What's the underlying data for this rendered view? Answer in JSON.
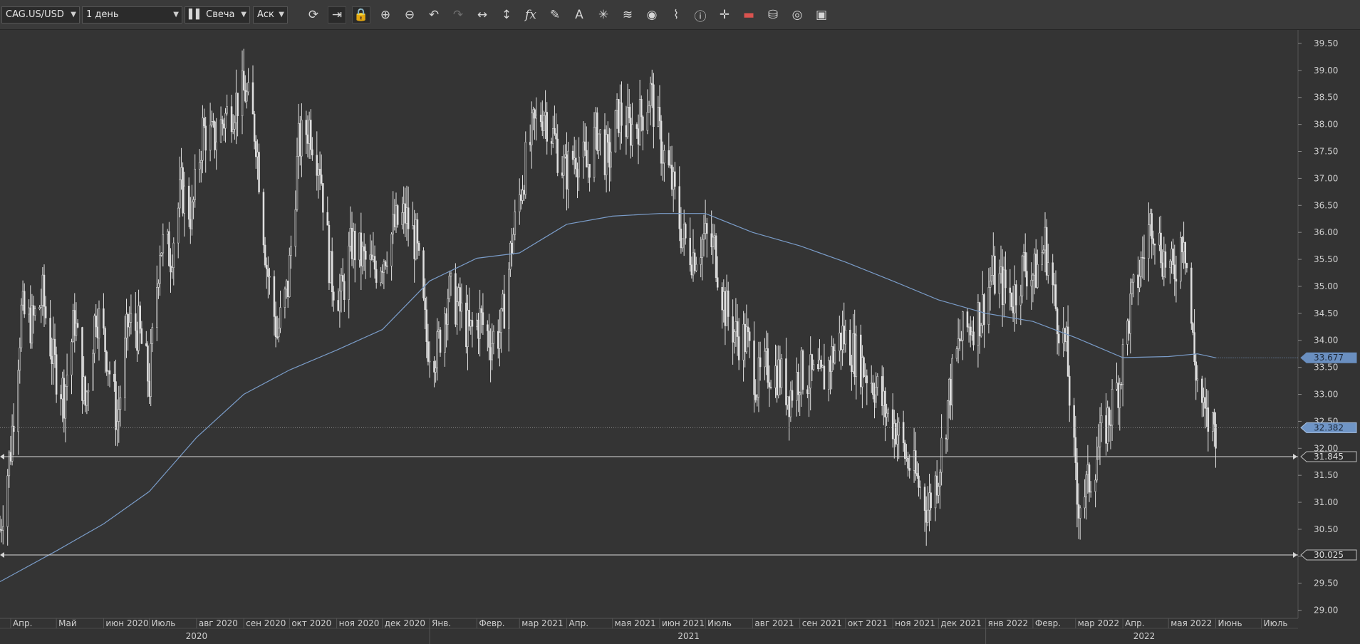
{
  "toolbar": {
    "symbol": "CAG.US/USD",
    "period": "1 день",
    "chart_type": "Свеча",
    "price_side": "Аск",
    "tools": [
      {
        "name": "refresh-icon",
        "glyph": "⟳"
      },
      {
        "name": "shift-chart-icon",
        "glyph": "⇥"
      },
      {
        "name": "lock-icon",
        "glyph": "🔒"
      },
      {
        "name": "zoom-in-icon",
        "glyph": "⊕"
      },
      {
        "name": "zoom-out-icon",
        "glyph": "⊖"
      },
      {
        "name": "undo-icon",
        "glyph": "↶"
      },
      {
        "name": "redo-icon",
        "glyph": "↷"
      },
      {
        "name": "horizontal-stretch-icon",
        "glyph": "↔"
      },
      {
        "name": "vertical-stretch-icon",
        "glyph": "↕"
      },
      {
        "name": "indicators-fx-icon",
        "glyph": "fx"
      },
      {
        "name": "pencil-icon",
        "glyph": "✎"
      },
      {
        "name": "text-tool-icon",
        "glyph": "A"
      },
      {
        "name": "crosshair-tool-icon",
        "glyph": "✳"
      },
      {
        "name": "layers-icon",
        "glyph": "≋"
      },
      {
        "name": "eye-icon",
        "glyph": "◉"
      },
      {
        "name": "alerts-chart-icon",
        "glyph": "⌇"
      },
      {
        "name": "info-icon",
        "glyph": "ⓘ"
      },
      {
        "name": "cursor-cross-icon",
        "glyph": "✛"
      },
      {
        "name": "color-bar-icon",
        "glyph": "▬"
      },
      {
        "name": "paint-bucket-icon",
        "glyph": "⛁"
      },
      {
        "name": "settings-ring-icon",
        "glyph": "◎"
      },
      {
        "name": "save-icon",
        "glyph": "▣"
      }
    ]
  },
  "chart_data": {
    "type": "candlestick",
    "symbol": "CAG.US/USD",
    "timeframe": "1 день",
    "y_ticks": [
      "39.50",
      "39.00",
      "38.50",
      "38.00",
      "37.50",
      "37.00",
      "36.50",
      "36.00",
      "35.50",
      "35.00",
      "34.50",
      "34.00",
      "33.50",
      "33.00",
      "32.50",
      "32.00",
      "31.50",
      "31.00",
      "30.50",
      "30.00",
      "29.50",
      "29.00"
    ],
    "ylim": [
      28.85,
      39.75
    ],
    "x_range": [
      "2020-03-25",
      "2022-07-25"
    ],
    "x_ticks": [
      {
        "date": "2020-04-01",
        "label": "Апр."
      },
      {
        "date": "2020-05-01",
        "label": "Май"
      },
      {
        "date": "2020-06-01",
        "label": "июн 2020"
      },
      {
        "date": "2020-07-01",
        "label": "Июль"
      },
      {
        "date": "2020-08-01",
        "label": "авг 2020"
      },
      {
        "date": "2020-09-01",
        "label": "сен 2020"
      },
      {
        "date": "2020-10-01",
        "label": "окт 2020"
      },
      {
        "date": "2020-11-01",
        "label": "ноя 2020"
      },
      {
        "date": "2020-12-01",
        "label": "дек 2020"
      },
      {
        "date": "2021-01-01",
        "label": "Янв."
      },
      {
        "date": "2021-02-01",
        "label": "Февр."
      },
      {
        "date": "2021-03-01",
        "label": "мар 2021"
      },
      {
        "date": "2021-04-01",
        "label": "Апр."
      },
      {
        "date": "2021-05-01",
        "label": "мая 2021"
      },
      {
        "date": "2021-06-01",
        "label": "июн 2021"
      },
      {
        "date": "2021-07-01",
        "label": "Июль"
      },
      {
        "date": "2021-08-01",
        "label": "авг 2021"
      },
      {
        "date": "2021-09-01",
        "label": "сен 2021"
      },
      {
        "date": "2021-10-01",
        "label": "окт 2021"
      },
      {
        "date": "2021-11-01",
        "label": "ноя 2021"
      },
      {
        "date": "2021-12-01",
        "label": "дек 2021"
      },
      {
        "date": "2022-01-01",
        "label": "янв 2022"
      },
      {
        "date": "2022-02-01",
        "label": "Февр."
      },
      {
        "date": "2022-03-01",
        "label": "мар 2022"
      },
      {
        "date": "2022-04-01",
        "label": "Апр."
      },
      {
        "date": "2022-05-01",
        "label": "мая 2022"
      },
      {
        "date": "2022-06-01",
        "label": "Июнь"
      },
      {
        "date": "2022-07-01",
        "label": "Июль"
      }
    ],
    "year_labels": [
      {
        "date": "2020-08-01",
        "label": "2020"
      },
      {
        "date": "2021-06-20",
        "label": "2021"
      },
      {
        "date": "2022-04-15",
        "label": "2022"
      }
    ],
    "year_boundaries": [
      "2021-01-01",
      "2022-01-01"
    ],
    "closes": [
      {
        "date": "2020-03-25",
        "value": 30.5
      },
      {
        "date": "2020-04-01",
        "value": 32.0
      },
      {
        "date": "2020-04-08",
        "value": 34.5
      },
      {
        "date": "2020-04-15",
        "value": 34.3
      },
      {
        "date": "2020-04-22",
        "value": 34.8
      },
      {
        "date": "2020-04-29",
        "value": 33.6
      },
      {
        "date": "2020-05-06",
        "value": 33.0
      },
      {
        "date": "2020-05-13",
        "value": 34.4
      },
      {
        "date": "2020-05-20",
        "value": 32.8
      },
      {
        "date": "2020-05-27",
        "value": 34.6
      },
      {
        "date": "2020-06-03",
        "value": 33.8
      },
      {
        "date": "2020-06-10",
        "value": 32.5
      },
      {
        "date": "2020-06-17",
        "value": 34.3
      },
      {
        "date": "2020-06-24",
        "value": 34.2
      },
      {
        "date": "2020-07-01",
        "value": 33.2
      },
      {
        "date": "2020-07-08",
        "value": 35.8
      },
      {
        "date": "2020-07-15",
        "value": 35.6
      },
      {
        "date": "2020-07-22",
        "value": 36.8
      },
      {
        "date": "2020-07-29",
        "value": 36.3
      },
      {
        "date": "2020-08-05",
        "value": 37.9
      },
      {
        "date": "2020-08-12",
        "value": 37.7
      },
      {
        "date": "2020-08-19",
        "value": 38.1
      },
      {
        "date": "2020-08-26",
        "value": 38.4
      },
      {
        "date": "2020-09-02",
        "value": 38.6
      },
      {
        "date": "2020-09-09",
        "value": 37.8
      },
      {
        "date": "2020-09-16",
        "value": 35.4
      },
      {
        "date": "2020-09-23",
        "value": 34.1
      },
      {
        "date": "2020-09-30",
        "value": 35.0
      },
      {
        "date": "2020-10-07",
        "value": 37.6
      },
      {
        "date": "2020-10-14",
        "value": 38.0
      },
      {
        "date": "2020-10-21",
        "value": 37.3
      },
      {
        "date": "2020-10-28",
        "value": 35.2
      },
      {
        "date": "2020-11-04",
        "value": 34.8
      },
      {
        "date": "2020-11-11",
        "value": 35.8
      },
      {
        "date": "2020-11-18",
        "value": 35.5
      },
      {
        "date": "2020-11-25",
        "value": 35.3
      },
      {
        "date": "2020-12-02",
        "value": 35.6
      },
      {
        "date": "2020-12-09",
        "value": 36.1
      },
      {
        "date": "2020-12-16",
        "value": 36.3
      },
      {
        "date": "2020-12-23",
        "value": 35.8
      },
      {
        "date": "2020-12-30",
        "value": 34.0
      },
      {
        "date": "2021-01-06",
        "value": 33.8
      },
      {
        "date": "2021-01-13",
        "value": 34.9
      },
      {
        "date": "2021-01-20",
        "value": 34.6
      },
      {
        "date": "2021-01-27",
        "value": 34.1
      },
      {
        "date": "2021-02-03",
        "value": 34.4
      },
      {
        "date": "2021-02-10",
        "value": 34.0
      },
      {
        "date": "2021-02-17",
        "value": 34.2
      },
      {
        "date": "2021-02-24",
        "value": 35.8
      },
      {
        "date": "2021-03-03",
        "value": 37.0
      },
      {
        "date": "2021-03-10",
        "value": 37.9
      },
      {
        "date": "2021-03-17",
        "value": 38.3
      },
      {
        "date": "2021-03-24",
        "value": 37.7
      },
      {
        "date": "2021-03-31",
        "value": 37.1
      },
      {
        "date": "2021-04-07",
        "value": 37.5
      },
      {
        "date": "2021-04-14",
        "value": 37.2
      },
      {
        "date": "2021-04-21",
        "value": 37.9
      },
      {
        "date": "2021-04-28",
        "value": 37.3
      },
      {
        "date": "2021-05-05",
        "value": 38.2
      },
      {
        "date": "2021-05-12",
        "value": 37.9
      },
      {
        "date": "2021-05-19",
        "value": 38.1
      },
      {
        "date": "2021-05-26",
        "value": 38.6
      },
      {
        "date": "2021-06-02",
        "value": 37.6
      },
      {
        "date": "2021-06-09",
        "value": 36.9
      },
      {
        "date": "2021-06-16",
        "value": 35.9
      },
      {
        "date": "2021-06-23",
        "value": 35.6
      },
      {
        "date": "2021-06-30",
        "value": 35.9
      },
      {
        "date": "2021-07-07",
        "value": 35.7
      },
      {
        "date": "2021-07-14",
        "value": 34.6
      },
      {
        "date": "2021-07-21",
        "value": 34.1
      },
      {
        "date": "2021-07-28",
        "value": 34.0
      },
      {
        "date": "2021-08-04",
        "value": 33.2
      },
      {
        "date": "2021-08-11",
        "value": 33.5
      },
      {
        "date": "2021-08-18",
        "value": 33.4
      },
      {
        "date": "2021-08-25",
        "value": 33.0
      },
      {
        "date": "2021-09-01",
        "value": 33.4
      },
      {
        "date": "2021-09-08",
        "value": 33.3
      },
      {
        "date": "2021-09-15",
        "value": 33.2
      },
      {
        "date": "2021-09-22",
        "value": 33.7
      },
      {
        "date": "2021-09-29",
        "value": 34.1
      },
      {
        "date": "2021-10-06",
        "value": 33.8
      },
      {
        "date": "2021-10-13",
        "value": 33.5
      },
      {
        "date": "2021-10-20",
        "value": 33.2
      },
      {
        "date": "2021-10-27",
        "value": 32.7
      },
      {
        "date": "2021-11-03",
        "value": 32.4
      },
      {
        "date": "2021-11-10",
        "value": 31.8
      },
      {
        "date": "2021-11-17",
        "value": 31.4
      },
      {
        "date": "2021-11-24",
        "value": 30.9
      },
      {
        "date": "2021-12-01",
        "value": 31.6
      },
      {
        "date": "2021-12-08",
        "value": 33.0
      },
      {
        "date": "2021-12-15",
        "value": 34.0
      },
      {
        "date": "2021-12-22",
        "value": 34.3
      },
      {
        "date": "2021-12-29",
        "value": 34.5
      },
      {
        "date": "2022-01-05",
        "value": 35.2
      },
      {
        "date": "2022-01-12",
        "value": 35.0
      },
      {
        "date": "2022-01-19",
        "value": 34.8
      },
      {
        "date": "2022-01-26",
        "value": 35.4
      },
      {
        "date": "2022-02-02",
        "value": 35.2
      },
      {
        "date": "2022-02-09",
        "value": 35.8
      },
      {
        "date": "2022-02-16",
        "value": 34.6
      },
      {
        "date": "2022-02-23",
        "value": 33.8
      },
      {
        "date": "2022-03-02",
        "value": 31.0
      },
      {
        "date": "2022-03-09",
        "value": 31.3
      },
      {
        "date": "2022-03-16",
        "value": 32.0
      },
      {
        "date": "2022-03-23",
        "value": 32.6
      },
      {
        "date": "2022-03-30",
        "value": 33.3
      },
      {
        "date": "2022-04-06",
        "value": 34.6
      },
      {
        "date": "2022-04-13",
        "value": 35.4
      },
      {
        "date": "2022-04-20",
        "value": 36.3
      },
      {
        "date": "2022-04-27",
        "value": 35.6
      },
      {
        "date": "2022-05-04",
        "value": 35.2
      },
      {
        "date": "2022-05-11",
        "value": 36.1
      },
      {
        "date": "2022-05-18",
        "value": 33.6
      },
      {
        "date": "2022-05-25",
        "value": 32.5
      },
      {
        "date": "2022-06-01",
        "value": 32.4
      }
    ],
    "moving_average": [
      {
        "date": "2020-03-25",
        "value": 29.53
      },
      {
        "date": "2020-05-01",
        "value": 30.1
      },
      {
        "date": "2020-06-01",
        "value": 30.6
      },
      {
        "date": "2020-07-01",
        "value": 31.2
      },
      {
        "date": "2020-08-01",
        "value": 32.2
      },
      {
        "date": "2020-09-01",
        "value": 33.0
      },
      {
        "date": "2020-10-01",
        "value": 33.45
      },
      {
        "date": "2020-11-01",
        "value": 33.82
      },
      {
        "date": "2020-12-01",
        "value": 34.2
      },
      {
        "date": "2021-01-01",
        "value": 35.1
      },
      {
        "date": "2021-02-01",
        "value": 35.52
      },
      {
        "date": "2021-03-01",
        "value": 35.62
      },
      {
        "date": "2021-04-01",
        "value": 36.15
      },
      {
        "date": "2021-05-01",
        "value": 36.3
      },
      {
        "date": "2021-06-01",
        "value": 36.35
      },
      {
        "date": "2021-07-01",
        "value": 36.35
      },
      {
        "date": "2021-08-01",
        "value": 36.0
      },
      {
        "date": "2021-09-01",
        "value": 35.75
      },
      {
        "date": "2021-10-01",
        "value": 35.45
      },
      {
        "date": "2021-11-01",
        "value": 35.1
      },
      {
        "date": "2021-12-01",
        "value": 34.75
      },
      {
        "date": "2022-01-01",
        "value": 34.5
      },
      {
        "date": "2022-02-01",
        "value": 34.35
      },
      {
        "date": "2022-03-01",
        "value": 34.05
      },
      {
        "date": "2022-04-01",
        "value": 33.68
      },
      {
        "date": "2022-05-01",
        "value": 33.7
      },
      {
        "date": "2022-05-20",
        "value": 33.75
      },
      {
        "date": "2022-06-01",
        "value": 33.677
      }
    ],
    "price_labels": [
      {
        "value": 33.677,
        "text": "33.677",
        "style": "ma"
      },
      {
        "value": 32.382,
        "text": "32.382",
        "style": "ask"
      },
      {
        "value": 31.845,
        "text": "31.845",
        "style": "line"
      },
      {
        "value": 30.025,
        "text": "30.025",
        "style": "line"
      }
    ],
    "horizontal_lines": [
      31.845,
      30.025
    ],
    "dotted_lines": [
      33.677,
      32.382
    ],
    "colors": {
      "background": "#343434",
      "candle": "#e0e0e0",
      "ma": "#7a9cc8",
      "ask_label": "#6f95c6",
      "line": "#d8d8d8"
    }
  }
}
